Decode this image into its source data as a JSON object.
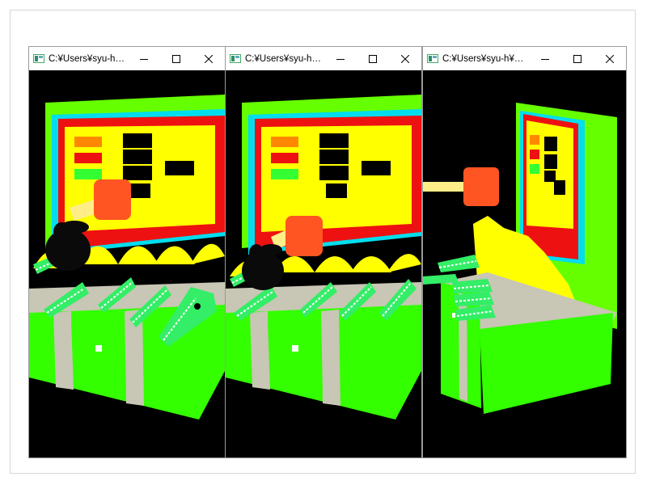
{
  "windows": [
    {
      "title": "C:¥Users¥syu-h¥Downl...",
      "controls": {
        "minimize": "minimize-icon",
        "maximize": "maximize-icon",
        "close": "close-icon"
      },
      "scene": "front view: hammer raised, mole hit"
    },
    {
      "title": "C:¥Users¥syu-h¥Downl...",
      "controls": {
        "minimize": "minimize-icon",
        "maximize": "maximize-icon",
        "close": "close-icon"
      },
      "scene": "front view: hammer lowered"
    },
    {
      "title": "C:¥Users¥syu-h¥Downl...",
      "controls": {
        "minimize": "minimize-icon",
        "maximize": "maximize-icon",
        "close": "close-icon"
      },
      "scene": "side view"
    }
  ],
  "colors": {
    "cabinet_green": "#33ff00",
    "cabinet_top": "#66ff00",
    "cyan_frame": "#00ddee",
    "red_panel": "#ee1111",
    "yellow_panel": "#ffff00",
    "hammer_head": "#ff5522",
    "hammer_handle": "#ffee88",
    "croc_green": "#33ee66",
    "floor_gray": "#c8c6b4"
  }
}
